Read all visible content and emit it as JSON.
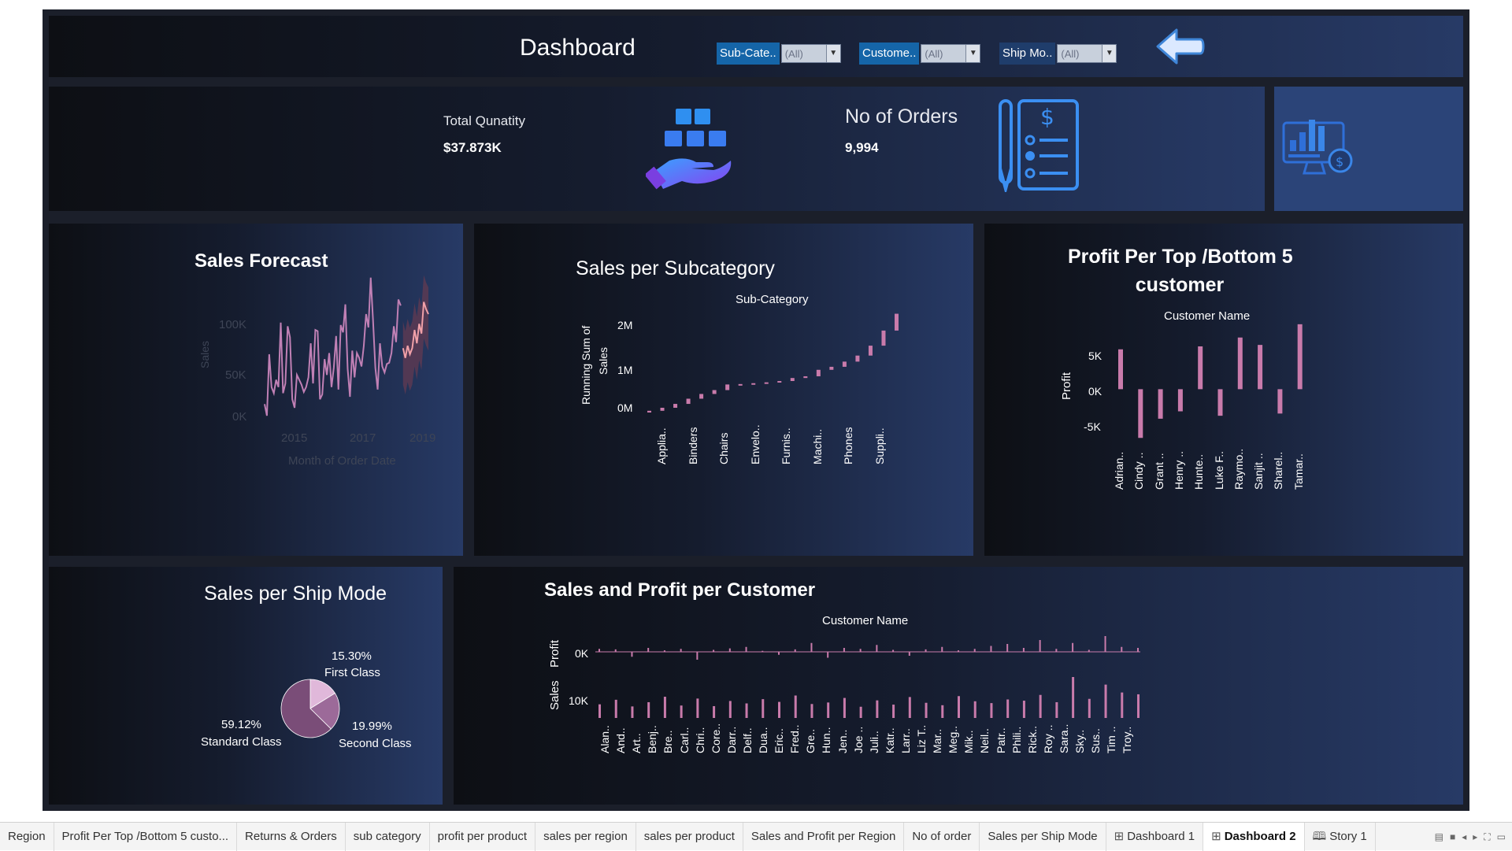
{
  "header": {
    "title": "Dashboard"
  },
  "filters": [
    {
      "label": "Sub-Cate..",
      "value": "(All)"
    },
    {
      "label": "Custome..",
      "value": "(All)"
    },
    {
      "label": "Ship Mo..",
      "value": "(All)"
    }
  ],
  "kpis": {
    "quantity_label": "Total Qunatity",
    "quantity_value": "$37.873K",
    "orders_label": "No of Orders",
    "orders_value": "9,994"
  },
  "icons": {
    "back": "back-arrow-icon",
    "boxes": "boxes-hand-icon",
    "orders": "order-list-icon",
    "monitor": "monitor-chart-icon"
  },
  "colors": {
    "filter_label_bg": "#1565a8",
    "accent_pink": "#c97bab",
    "forecast_line": "#c080b5",
    "forecast_band": "#5a3a52",
    "pie_standard": "#7a4d78",
    "pie_second": "#9c6a99",
    "pie_first": "#e0b8da"
  },
  "forecast": {
    "title": "Sales Forecast",
    "ylabel": "Sales",
    "xlabel": "Month of Order Date",
    "yticks": [
      "100K",
      "50K",
      "0K"
    ],
    "xticks": [
      "2015",
      "2017",
      "2019"
    ]
  },
  "subcat": {
    "title": "Sales per Subcategory",
    "header": "Sub-Category",
    "ylabel_line1": "Running Sum of",
    "ylabel_line2": "Sales",
    "yticks": [
      "2M",
      "1M",
      "0M"
    ],
    "xticks": [
      "Applia..",
      "Binders",
      "Chairs",
      "Envelo..",
      "Furnis..",
      "Machi..",
      "Phones",
      "Suppli.."
    ]
  },
  "profit": {
    "title_line1": "Profit Per Top /Bottom 5",
    "title_line2": "customer",
    "header": "Customer Name",
    "ylabel": "Profit",
    "yticks": [
      "5K",
      "0K",
      "-5K"
    ],
    "xticks": [
      "Adrian..",
      "Cindy ..",
      "Grant ..",
      "Henry ..",
      "Hunte..",
      "Luke F..",
      "Raymo..",
      "Sanjit ..",
      "Sharel..",
      "Tamar.."
    ]
  },
  "ship": {
    "title": "Sales per Ship Mode",
    "slices": [
      {
        "pct": "15.30%",
        "name": "First Class"
      },
      {
        "pct": "19.99%",
        "name": "Second Class"
      },
      {
        "pct": "59.12%",
        "name": "Standard Class"
      }
    ]
  },
  "customer": {
    "title": "Sales and Profit per Customer",
    "header": "Customer Name",
    "profit_label": "Profit",
    "sales_label": "Sales",
    "profit_tick": "0K",
    "sales_tick": "10K",
    "xticks": [
      "Alan..",
      "And..",
      "Art..",
      "Benj..",
      "Bre..",
      "Carl..",
      "Chri..",
      "Core..",
      "Darr..",
      "Delf..",
      "Dua..",
      "Eric..",
      "Fred..",
      "Gre..",
      "Hun..",
      "Jen..",
      "Joe ..",
      "Juli..",
      "Katr..",
      "Larr..",
      "Liz T..",
      "Mar..",
      "Meg..",
      "Mik..",
      "Neil..",
      "Patr..",
      "Phili..",
      "Rick..",
      "Roy ..",
      "Sara..",
      "Sky..",
      "Sus..",
      "Tim ..",
      "Troy.."
    ]
  },
  "chart_data": [
    {
      "type": "line",
      "title": "Sales Forecast",
      "xlabel": "Month of Order Date",
      "ylabel": "Sales",
      "xlim": [
        2014,
        2020
      ],
      "ylim": [
        0,
        110000
      ],
      "series": [
        {
          "values": [
            14000,
            4500,
            55000,
            28000,
            23000,
            34000,
            28000,
            81000,
            23000,
            31000,
            78000,
            69000,
            18000,
            11000,
            38000,
            34000,
            30000,
            24000,
            28000,
            36000,
            64000,
            31000,
            75000,
            74000,
            18000,
            22000,
            51000,
            38000,
            56000,
            28000,
            44000,
            70000,
            26000,
            79000,
            73000,
            96000,
            43000,
            20000,
            58000,
            36000,
            56000,
            52000,
            45000,
            62000,
            88000,
            77000,
            118000,
            83000,
            44000,
            26000,
            64000,
            45000,
            40000,
            47000,
            48000,
            56000,
            78000,
            65000,
            100000,
            95000
          ]
        },
        {
          "values": [
            60000,
            52000,
            62000,
            55000,
            60000,
            75000,
            64000,
            80000,
            72000,
            98000,
            92000,
            88000
          ]
        }
      ]
    },
    {
      "type": "bar",
      "title": "Sales per Subcategory",
      "categories": [
        "Applia..",
        "Binders",
        "Chairs",
        "Envelo..",
        "Furnis..",
        "Machi..",
        "Phones",
        "Suppli.."
      ],
      "values": [
        110000,
        320000,
        650000,
        680000,
        800000,
        990000,
        1320000,
        2290000
      ],
      "ylabel": "Running Sum of Sales",
      "ylim": [
        0,
        2300000
      ]
    },
    {
      "type": "bar",
      "title": "Profit Per Top /Bottom 5 customer",
      "categories": [
        "Adrian..",
        "Cindy ..",
        "Grant ..",
        "Henry ..",
        "Hunte..",
        "Luke F..",
        "Raymo..",
        "Sanjit ..",
        "Sharel..",
        "Tamar.."
      ],
      "values": [
        5400,
        -6600,
        -4000,
        -3000,
        5800,
        -3600,
        7000,
        6000,
        -3300,
        8800
      ],
      "ylabel": "Profit",
      "ylim": [
        -7000,
        9000
      ]
    },
    {
      "type": "pie",
      "title": "Sales per Ship Mode",
      "categories": [
        "First Class",
        "Second Class",
        "Standard Class"
      ],
      "values": [
        15.3,
        19.99,
        59.12
      ]
    },
    {
      "type": "bar",
      "title": "Sales and Profit per Customer",
      "categories": [
        "Alan..",
        "And..",
        "Art..",
        "Benj..",
        "Bre..",
        "Carl..",
        "Chri..",
        "Core..",
        "Darr..",
        "Delf..",
        "Dua..",
        "Eric..",
        "Fred..",
        "Gre..",
        "Hun..",
        "Jen..",
        "Joe ..",
        "Juli..",
        "Katr..",
        "Larr..",
        "Liz T..",
        "Mar..",
        "Meg..",
        "Mik..",
        "Neil..",
        "Patr..",
        "Phili..",
        "Rick..",
        "Roy ..",
        "Sara..",
        "Sky..",
        "Sus..",
        "Tim ..",
        "Troy.."
      ],
      "series": [
        {
          "name": "Profit",
          "values": [
            300,
            250,
            -500,
            400,
            150,
            300,
            -800,
            200,
            350,
            500,
            100,
            -300,
            250,
            900,
            -600,
            400,
            300,
            700,
            200,
            -400,
            250,
            500,
            150,
            300,
            600,
            800,
            400,
            1200,
            300,
            900,
            200,
            1600,
            500,
            400
          ]
        },
        {
          "name": "Sales",
          "values": [
            4500,
            6000,
            3800,
            5200,
            7000,
            4100,
            6400,
            3900,
            5600,
            4800,
            6200,
            5300,
            7400,
            4600,
            5100,
            6600,
            3700,
            5800,
            4400,
            6900,
            5000,
            4200,
            7200,
            5500,
            4900,
            6100,
            5700,
            7600,
            5200,
            13500,
            6300,
            11000,
            8400,
            7800
          ]
        }
      ]
    }
  ],
  "tabs": [
    {
      "label": "Region",
      "icon": ""
    },
    {
      "label": "Profit Per Top /Bottom 5 custo...",
      "icon": ""
    },
    {
      "label": "Returns & Orders",
      "icon": ""
    },
    {
      "label": "sub category",
      "icon": ""
    },
    {
      "label": "profit per product",
      "icon": ""
    },
    {
      "label": "sales per region",
      "icon": ""
    },
    {
      "label": "sales per product",
      "icon": ""
    },
    {
      "label": "Sales and Profit per Region",
      "icon": ""
    },
    {
      "label": "No of order",
      "icon": ""
    },
    {
      "label": "Sales per Ship Mode",
      "icon": ""
    },
    {
      "label": "Dashboard 1",
      "icon": "⊞"
    },
    {
      "label": "Dashboard 2",
      "icon": "⊞",
      "active": true
    },
    {
      "label": "Story 1",
      "icon": "🕮"
    }
  ]
}
